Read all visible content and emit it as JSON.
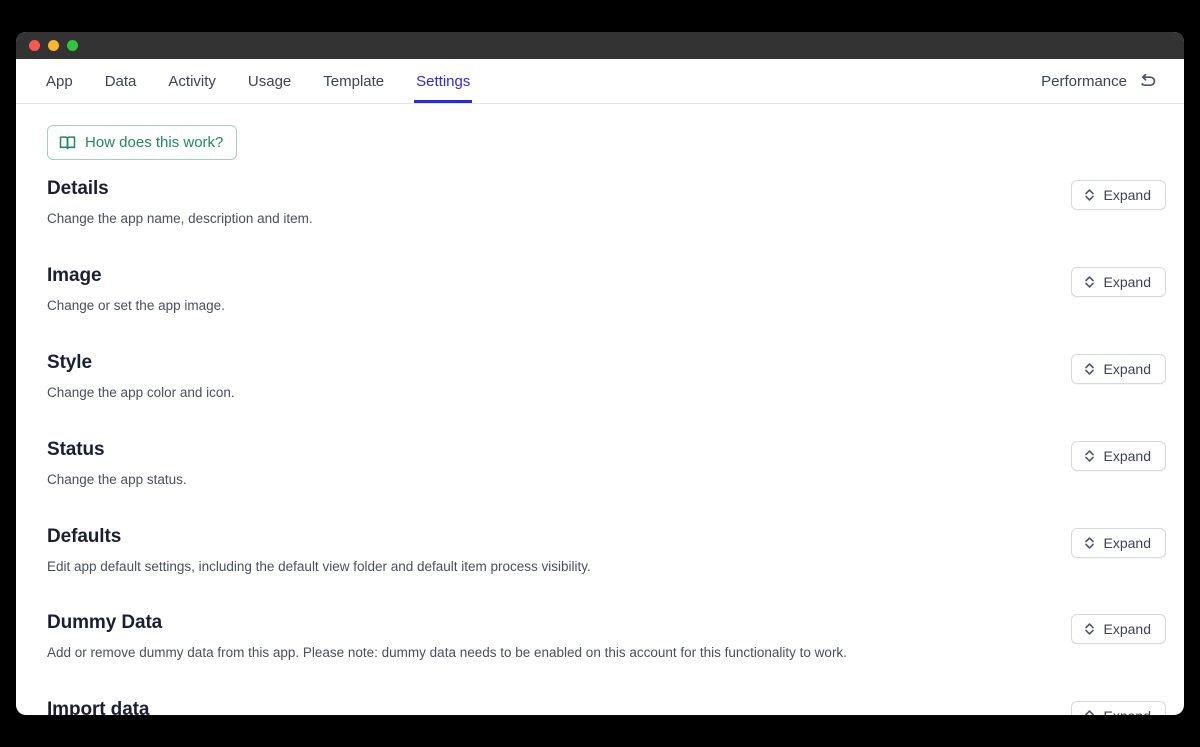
{
  "window": {
    "traffic_lights": [
      {
        "name": "close",
        "color": "#f9574f"
      },
      {
        "name": "minimize",
        "color": "#f9b52c"
      },
      {
        "name": "maximize",
        "color": "#2fc83c"
      }
    ]
  },
  "tabbar": {
    "tabs": [
      {
        "label": "App",
        "active": false
      },
      {
        "label": "Data",
        "active": false
      },
      {
        "label": "Activity",
        "active": false
      },
      {
        "label": "Usage",
        "active": false
      },
      {
        "label": "Template",
        "active": false
      },
      {
        "label": "Settings",
        "active": true
      }
    ],
    "active_tab": "Settings",
    "accent_color": "#2a2ae6",
    "performance_label": "Performance",
    "undo_icon": "undo-arrow-icon"
  },
  "help_button": {
    "label": "How does this work?",
    "icon": "book-icon",
    "color": "#1f8a5b",
    "border_color": "#9ed5b9"
  },
  "settings": {
    "expand_label": "Expand",
    "expand_icon": "chevron-up-down-icon",
    "sections": [
      {
        "title": "Details",
        "description": "Change the app name, description and item."
      },
      {
        "title": "Image",
        "description": "Change or set the app image."
      },
      {
        "title": "Style",
        "description": "Change the app color and icon."
      },
      {
        "title": "Status",
        "description": "Change the app status."
      },
      {
        "title": "Defaults",
        "description": "Edit app default settings, including the default view folder and default item process visibility."
      },
      {
        "title": "Dummy Data",
        "description": "Add or remove dummy data from this app. Please note: dummy data needs to be enabled on this account for this functionality to work."
      },
      {
        "title": "Import data",
        "description": ""
      }
    ]
  }
}
